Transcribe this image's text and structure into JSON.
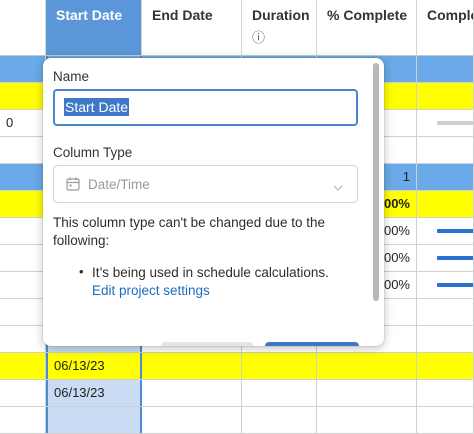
{
  "colors": {
    "header_active": "#5a96d8",
    "row_blue": "#6aaae8",
    "row_yellow": "#ffff00",
    "selected_col": "#c9dcf3",
    "progress_bar": "#2b6fd1",
    "progress_track": "#cfcfcf",
    "link": "#1a6dc2"
  },
  "headers": [
    {
      "label": "Start Date",
      "sub": ""
    },
    {
      "label": "End Date",
      "sub": ""
    },
    {
      "label": "Duration",
      "sub": "ⓘ"
    },
    {
      "label": "% Complete",
      "sub": ""
    },
    {
      "label": "Comple Progres",
      "sub": ""
    }
  ],
  "rows": [
    {
      "color": "row_blue",
      "c0": "",
      "c3": "",
      "progress": null
    },
    {
      "color": "row_yellow",
      "c0": "",
      "c3": "",
      "progress": null
    },
    {
      "color": "white",
      "c0": "0",
      "c3": "",
      "progress": 0
    },
    {
      "color": "white",
      "c0": "",
      "c3": "",
      "progress": null
    },
    {
      "color": "row_blue",
      "c0": "",
      "c3": "1",
      "progress": null
    },
    {
      "color": "row_yellow",
      "c0": "",
      "c3": "00%",
      "progress": null
    },
    {
      "color": "white",
      "c0": "",
      "c3": "00%",
      "progress": 1
    },
    {
      "color": "white",
      "c0": "",
      "c3": "00%",
      "progress": 1
    },
    {
      "color": "white",
      "c0": "",
      "c3": "00%",
      "progress": 1
    },
    {
      "color": "white",
      "c0": "",
      "c3": "",
      "progress": null
    },
    {
      "color": "white",
      "c0": "",
      "c3": "",
      "progress": null
    },
    {
      "color": "row_yellow",
      "c0": "",
      "c3": "",
      "startdate": "06/13/23",
      "progress": null
    },
    {
      "color": "white",
      "c0": "",
      "c3": "",
      "startdate": "06/13/23",
      "progress": null
    },
    {
      "color": "white",
      "c0": "",
      "c3": "",
      "startdate": "",
      "progress": null
    }
  ],
  "popup": {
    "name_label": "Name",
    "name_value": "Start Date",
    "column_type_label": "Column Type",
    "column_type_value": "Date/Time",
    "notice_line1": "This column type can't be changed due to the",
    "notice_line2": "following:",
    "bullet": "It’s being used in schedule calculations.",
    "link_text": "Edit project settings",
    "calendar_icon": "calendar-icon",
    "chevron_icon": "chevron-down-icon"
  }
}
